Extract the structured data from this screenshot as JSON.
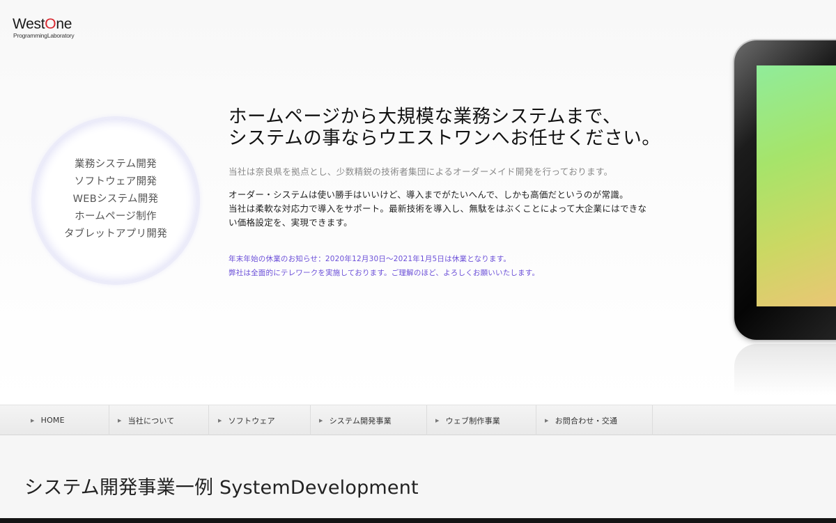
{
  "logo": {
    "west": "West",
    "o": "O",
    "ne": "ne",
    "sub": "ProgrammingLaboratory"
  },
  "services": [
    "業務システム開発",
    "ソフトウェア開発",
    "WEBシステム開発",
    "ホームページ制作",
    "タブレットアプリ開発"
  ],
  "hero": {
    "headline_1": "ホームページから大規模な業務システムまで、",
    "headline_2": "システムの事ならウエストワンへお任せください。",
    "intro": "当社は奈良県を拠点とし、少数精鋭の技術者集団によるオーダーメイド開発を行っております。",
    "body_1": "オーダー・システムは使い勝手はいいけど、導入までがたいへんで、しかも高価だというのが常識。",
    "body_2": "当社は柔軟な対応力で導入をサポート。最新技術を導入し、無駄をはぶくことによって大企業にはできな",
    "body_3": "い価格設定を、実現できます。",
    "notice_1": "年末年始の休業のお知らせ：2020年12月30日〜2021年1月5日は休業となります。",
    "notice_2": "弊社は全面的にテレワークを実施しております。ご理解のほど、よろしくお願いいたします。"
  },
  "nav": {
    "items": [
      {
        "label": "HOME"
      },
      {
        "label": "当社について"
      },
      {
        "label": "ソフトウェア"
      },
      {
        "label": "システム開発事業"
      },
      {
        "label": "ウェブ制作事業"
      },
      {
        "label": "お問合わせ・交通"
      }
    ]
  },
  "section": {
    "title": "システム開発事業一例 SystemDevelopment"
  },
  "colors": {
    "accent_red": "#d8262d",
    "notice_purple": "#6b4fd8",
    "circle_glow": "#e2e2f7"
  }
}
